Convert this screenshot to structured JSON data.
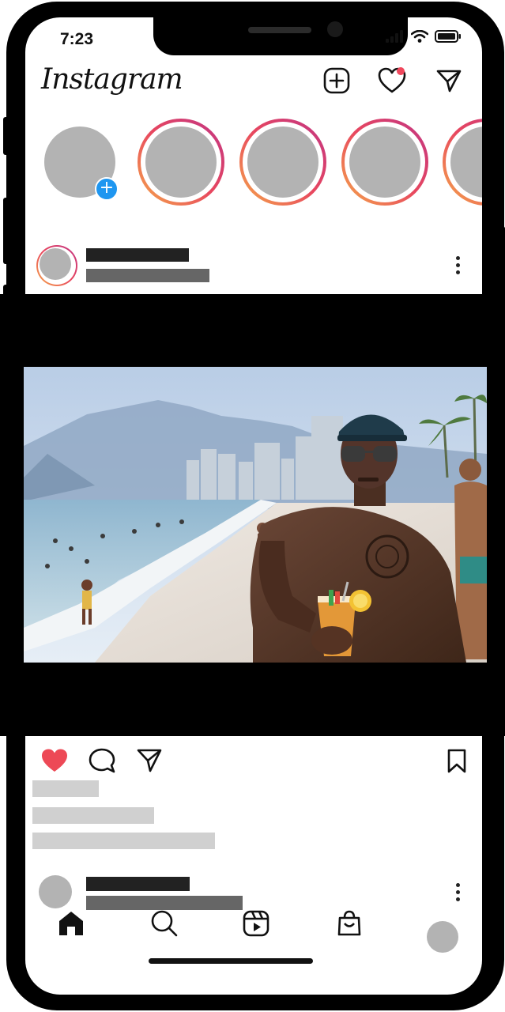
{
  "status_bar": {
    "time": "7:23"
  },
  "header": {
    "logo_text": "Instagram",
    "icons": [
      "new-post-icon",
      "activity-heart-icon",
      "direct-message-icon"
    ],
    "notification_dot_color": "#f0475c"
  },
  "stories": {
    "own_badge": "+",
    "ring_gradient": [
      "#f5a94a",
      "#e8475f",
      "#c13584"
    ],
    "count_visible": 4
  },
  "post": {
    "photo_subject": "man on beach holding a drink",
    "like_active_color": "#ed4956",
    "actions": [
      "like-icon",
      "comment-icon",
      "share-icon",
      "bookmark-icon"
    ]
  },
  "bottom_nav": {
    "items": [
      "home-icon",
      "search-icon",
      "reels-icon",
      "shop-icon",
      "profile-avatar"
    ]
  },
  "colors": {
    "placeholder_dark": "#222222",
    "placeholder_mid": "#666666",
    "placeholder_light": "#d0d0d0",
    "avatar_gray": "#b3b3b3",
    "badge_blue": "#1e96f0"
  }
}
